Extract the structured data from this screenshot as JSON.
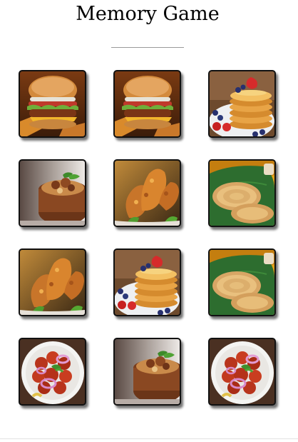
{
  "title": "Memory Game",
  "cards": [
    {
      "food": "burger",
      "icon": "burger-image"
    },
    {
      "food": "burger",
      "icon": "burger-image"
    },
    {
      "food": "pancakes",
      "icon": "pancakes-image"
    },
    {
      "food": "biryani",
      "icon": "biryani-image"
    },
    {
      "food": "fried-chicken",
      "icon": "fried-chicken-image"
    },
    {
      "food": "paratha",
      "icon": "paratha-image"
    },
    {
      "food": "fried-chicken",
      "icon": "fried-chicken-image"
    },
    {
      "food": "pancakes",
      "icon": "pancakes-image"
    },
    {
      "food": "paratha",
      "icon": "paratha-image"
    },
    {
      "food": "chicken-65",
      "icon": "chicken-65-image"
    },
    {
      "food": "biryani",
      "icon": "biryani-image"
    },
    {
      "food": "chicken-65",
      "icon": "chicken-65-image"
    }
  ]
}
